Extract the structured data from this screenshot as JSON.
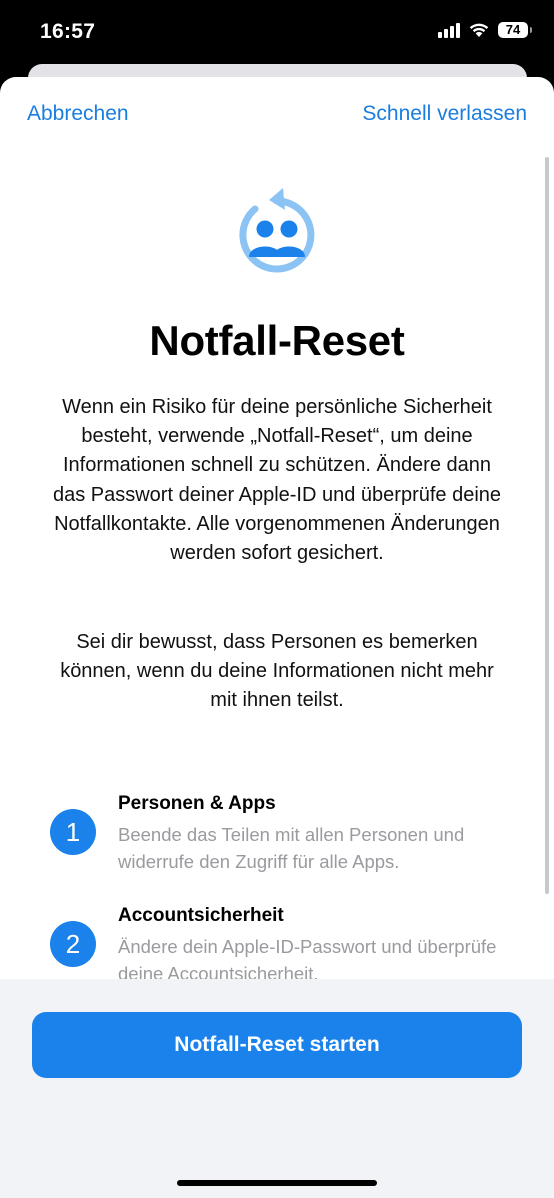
{
  "status_bar": {
    "time": "16:57",
    "battery": "74",
    "icons": [
      "cellular-signal-icon",
      "wifi-icon",
      "battery-icon"
    ]
  },
  "nav": {
    "cancel": "Abbrechen",
    "quick_exit": "Schnell verlassen"
  },
  "hero": {
    "icon": "people-reset-icon"
  },
  "title": "Notfall-Reset",
  "description": "Wenn ein Risiko für deine persönliche Sicherheit besteht, verwende „Notfall-Reset“, um deine Informationen schnell zu schützen. Ändere dann das Passwort deiner Apple-ID und überprüfe deine Notfallkontakte. Alle vorgenommenen Änderungen werden sofort gesichert.",
  "notice": "Sei dir bewusst, dass Personen es bemerken können, wenn du deine Informationen nicht mehr mit ihnen teilst.",
  "steps": [
    {
      "number": "1",
      "title": "Personen & Apps",
      "description": "Beende das Teilen mit allen Personen und widerrufe den Zugriff für alle Apps."
    },
    {
      "number": "2",
      "title": "Accountsicherheit",
      "description": "Ändere dein Apple-ID-Passwort und überprüfe deine Accountsicherheit."
    }
  ],
  "cta": {
    "label": "Notfall-Reset starten"
  },
  "colors": {
    "accent": "#1a82ea",
    "link": "#1a7de0",
    "secondary_text": "#9a9a9f"
  }
}
